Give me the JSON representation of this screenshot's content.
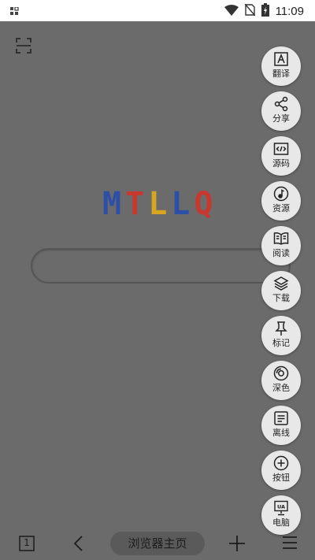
{
  "statusbar": {
    "time": "11:09"
  },
  "logo": {
    "letters": [
      "M",
      "T",
      "L",
      "L",
      "Q"
    ],
    "colors": [
      "#2d4fa8",
      "#c8382e",
      "#d8a520",
      "#2d4fa8",
      "#c8382e"
    ]
  },
  "search": {
    "placeholder": ""
  },
  "side_menu": {
    "items": [
      {
        "label": "翻译",
        "icon": "translate-icon"
      },
      {
        "label": "分享",
        "icon": "share-icon"
      },
      {
        "label": "源码",
        "icon": "code-icon"
      },
      {
        "label": "资源",
        "icon": "music-icon"
      },
      {
        "label": "阅读",
        "icon": "book-icon"
      },
      {
        "label": "下载",
        "icon": "layers-icon"
      },
      {
        "label": "标记",
        "icon": "pin-icon"
      },
      {
        "label": "深色",
        "icon": "dark-mode-icon"
      },
      {
        "label": "离线",
        "icon": "offline-icon"
      },
      {
        "label": "按钮",
        "icon": "plus-circle-icon"
      },
      {
        "label": "电脑",
        "icon": "desktop-ua-icon"
      }
    ]
  },
  "bottombar": {
    "tabs_count": "1",
    "home_label": "浏览器主页"
  }
}
